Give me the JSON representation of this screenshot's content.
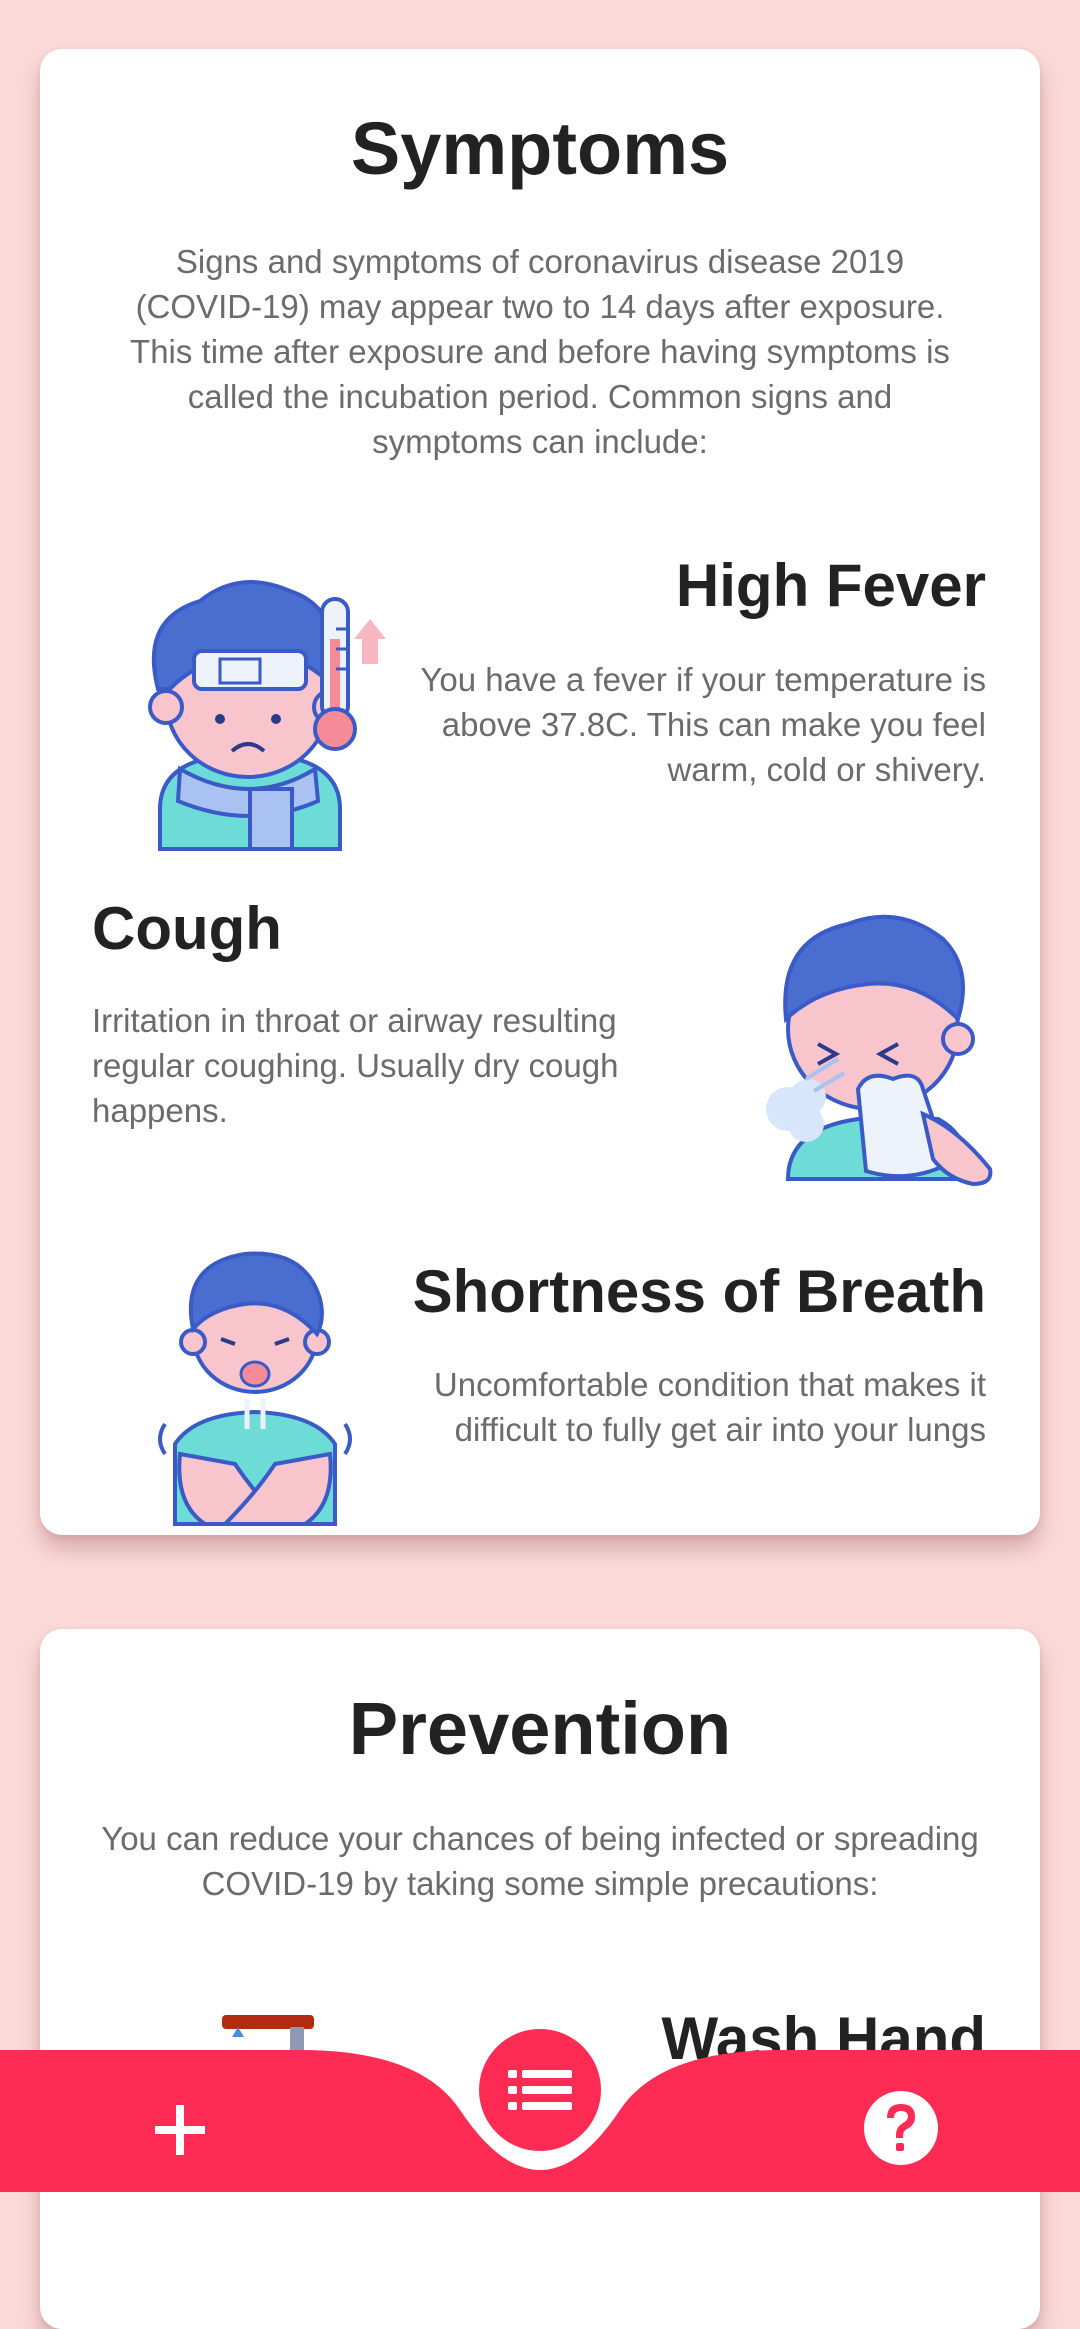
{
  "symptoms": {
    "title": "Symptoms",
    "intro": "Signs and symptoms of coronavirus disease 2019 (COVID-19) may appear two to 14 days after exposure. This time after exposure and before having symptoms is called the incubation period. Common signs and symptoms can include:",
    "items": [
      {
        "title": "High Fever",
        "description": "You have a fever if your temperature is above 37.8C. This can make you feel warm, cold or shivery.",
        "icon": "fever-illustration"
      },
      {
        "title": "Cough",
        "description": "Irritation in throat or airway resulting regular coughing. Usually dry cough happens.",
        "icon": "cough-illustration"
      },
      {
        "title": "Shortness of Breath",
        "description": "Uncomfortable condition that makes it difficult to fully get air into your lungs",
        "icon": "shortness-of-breath-illustration"
      }
    ]
  },
  "prevention": {
    "title": "Prevention",
    "intro": "You can reduce your chances of being infected or spreading COVID-19 by taking some simple precautions:",
    "items": [
      {
        "title": "Wash Hand",
        "icon": "wash-hand-illustration"
      }
    ]
  },
  "bottom_nav": {
    "add_icon": "plus-icon",
    "menu_icon": "list-icon",
    "help_icon": "help-icon",
    "accent_color": "#fe2c55"
  },
  "colors": {
    "background": "#fbdada",
    "card": "#ffffff",
    "title_text": "#222222",
    "body_text": "#6b6b6b"
  }
}
